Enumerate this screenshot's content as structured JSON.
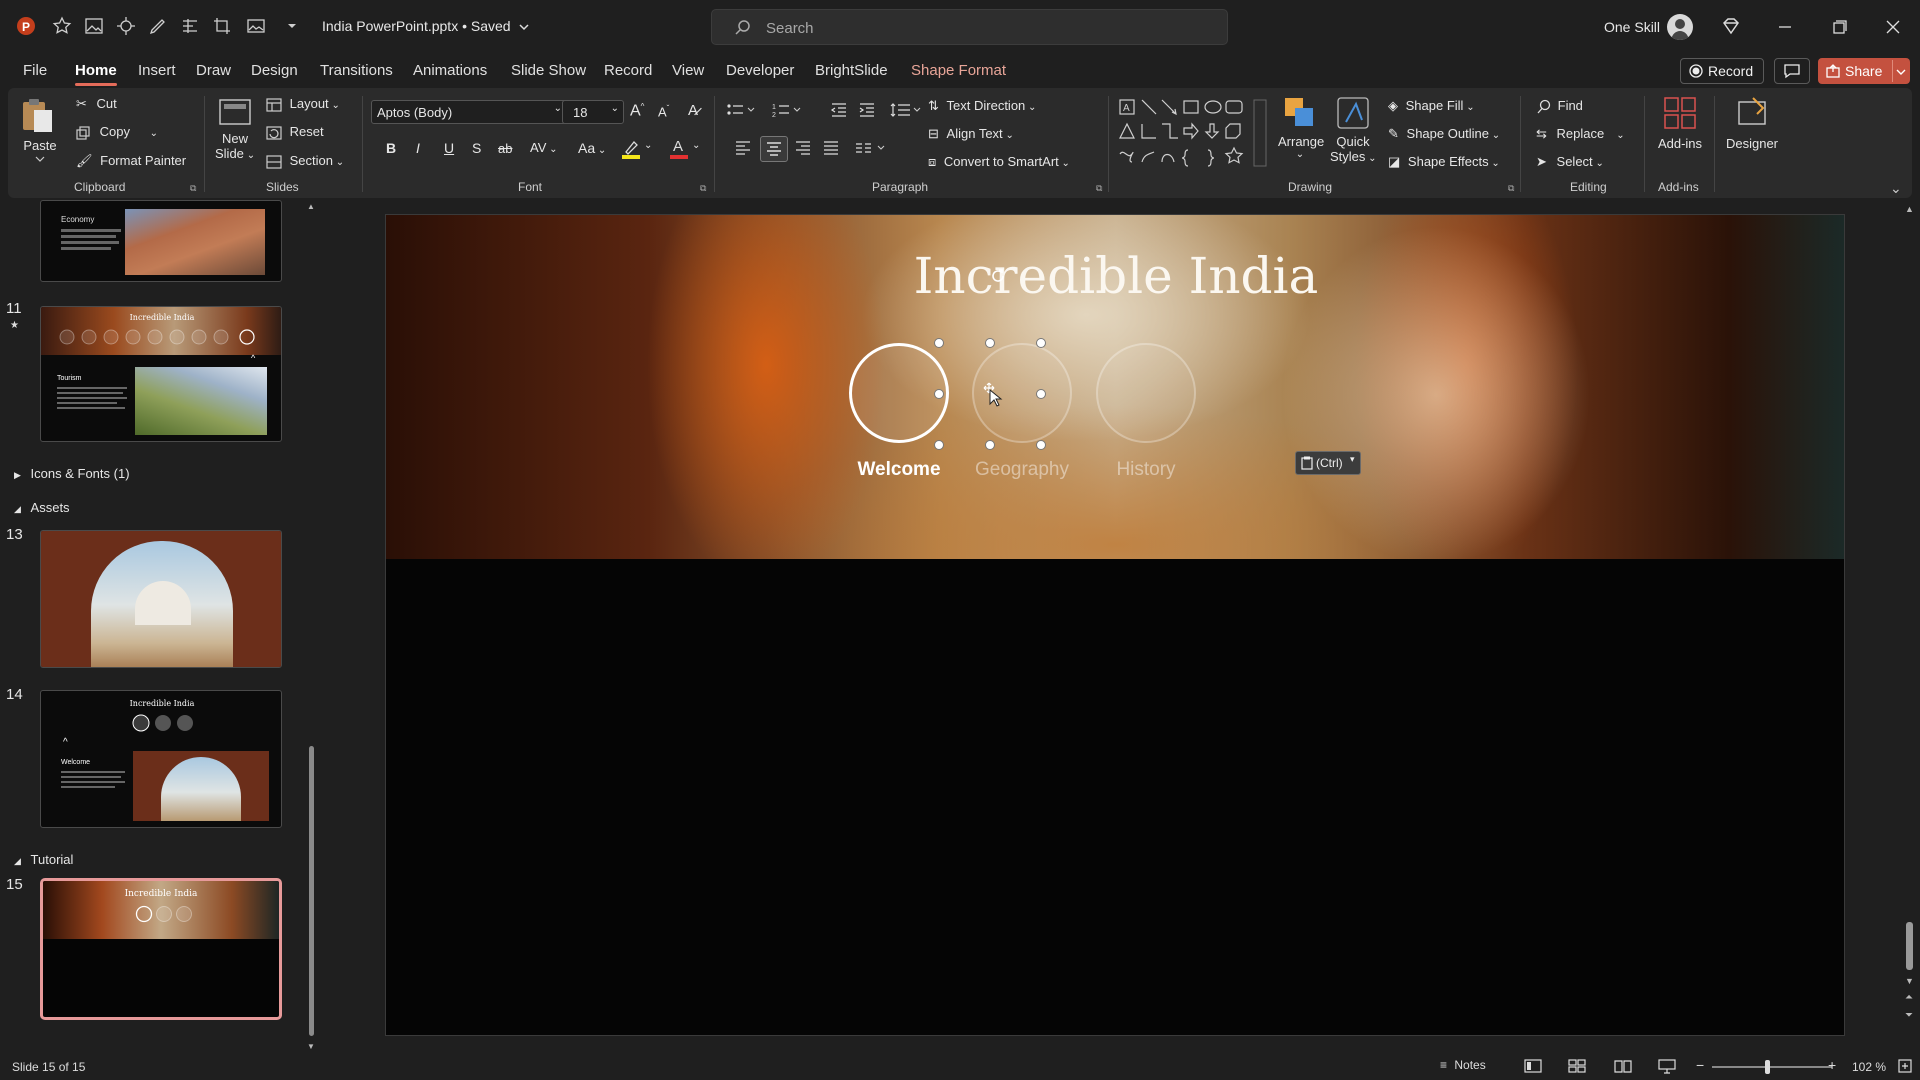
{
  "window": {
    "doc_title": "India PowerPoint.pptx • Saved",
    "search_placeholder": "Search",
    "user_name": "One Skill"
  },
  "tabs": [
    "File",
    "Home",
    "Insert",
    "Draw",
    "Design",
    "Transitions",
    "Animations",
    "Slide Show",
    "Record",
    "View",
    "Developer",
    "BrightSlide",
    "Shape Format"
  ],
  "active_tab": "Home",
  "top_buttons": {
    "record": "Record",
    "share": "Share"
  },
  "ribbon": {
    "clipboard": {
      "paste": "Paste",
      "cut": "Cut",
      "copy": "Copy",
      "format_painter": "Format Painter",
      "label": "Clipboard"
    },
    "slides": {
      "new_slide_1": "New",
      "new_slide_2": "Slide",
      "layout": "Layout",
      "reset": "Reset",
      "section": "Section",
      "label": "Slides"
    },
    "font": {
      "family": "Aptos (Body)",
      "size": "18",
      "bold": "B",
      "italic": "I",
      "underline": "U",
      "shadow": "S",
      "strike": "ab",
      "spacing": "AV",
      "case": "Aa",
      "label": "Font"
    },
    "paragraph": {
      "text_direction": "Text Direction",
      "align_text": "Align Text",
      "smartart": "Convert to SmartArt",
      "label": "Paragraph"
    },
    "drawing": {
      "arrange": "Arrange",
      "quick_styles_1": "Quick",
      "quick_styles_2": "Styles",
      "shape_fill": "Shape Fill",
      "shape_outline": "Shape Outline",
      "shape_effects": "Shape Effects",
      "label": "Drawing"
    },
    "editing": {
      "find": "Find",
      "replace": "Replace",
      "select": "Select",
      "label": "Editing"
    },
    "addins": {
      "addins": "Add-ins",
      "designer": "Designer",
      "label": "Add-ins"
    }
  },
  "thumbnails": {
    "slide_10": {
      "heading": "Economy"
    },
    "slide_11": {
      "num": "11",
      "title": "Incredible India",
      "heading": "Tourism"
    },
    "section_icons": "Icons & Fonts (1)",
    "section_assets": "Assets",
    "slide_13": {
      "num": "13"
    },
    "slide_14": {
      "num": "14",
      "title": "Incredible India",
      "heading": "Welcome"
    },
    "section_tutorial": "Tutorial",
    "slide_15": {
      "num": "15",
      "title": "Incredible India"
    }
  },
  "slide": {
    "title": "Incredible India",
    "circles": [
      "Welcome",
      "Geography",
      "History"
    ],
    "ctrl_chip": "(Ctrl)"
  },
  "status": {
    "slide_count": "Slide 15 of 15",
    "notes": "Notes",
    "zoom": "102 %"
  },
  "colors": {
    "accent": "#e46c5a",
    "share": "#c4513f",
    "selected_thumb": "#e79a9a"
  }
}
